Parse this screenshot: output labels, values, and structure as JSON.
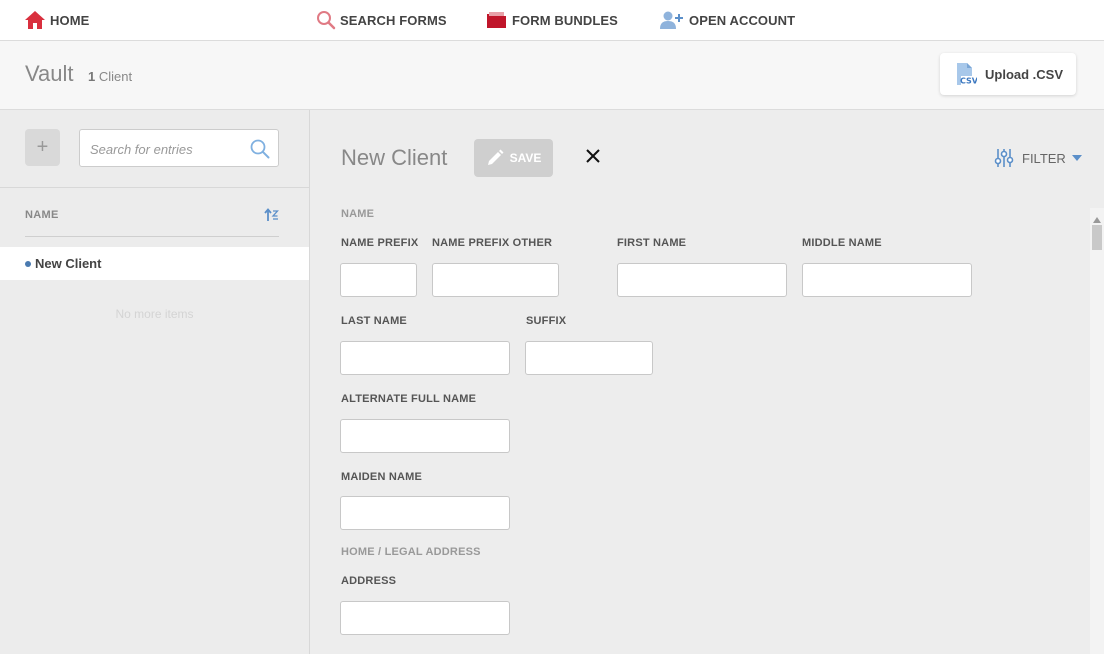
{
  "nav": {
    "home": "HOME",
    "search_forms": "SEARCH FORMS",
    "form_bundles": "FORM BUNDLES",
    "open_account": "OPEN ACCOUNT"
  },
  "header": {
    "title": "Vault",
    "count_number": "1",
    "count_label": "Client",
    "upload_label": "Upload .CSV"
  },
  "sidebar": {
    "add_label": "+",
    "search_placeholder": "Search for entries",
    "column_header": "NAME",
    "items": [
      {
        "label": "New Client"
      }
    ],
    "empty_text": "No more items"
  },
  "form": {
    "title": "New Client",
    "save_label": "SAVE",
    "filter_label": "FILTER",
    "sections": {
      "name": "NAME",
      "address": "HOME / LEGAL ADDRESS"
    },
    "fields": {
      "name_prefix": "NAME PREFIX",
      "name_prefix_other": "NAME PREFIX OTHER",
      "first_name": "FIRST NAME",
      "middle_name": "MIDDLE NAME",
      "last_name": "LAST NAME",
      "suffix": "SUFFIX",
      "alternate_full_name": "ALTERNATE FULL NAME",
      "maiden_name": "MAIDEN NAME",
      "address": "ADDRESS"
    }
  },
  "colors": {
    "accent_red": "#d9303e",
    "accent_blue": "#5b8fc9",
    "panel_bg": "#ededed"
  }
}
